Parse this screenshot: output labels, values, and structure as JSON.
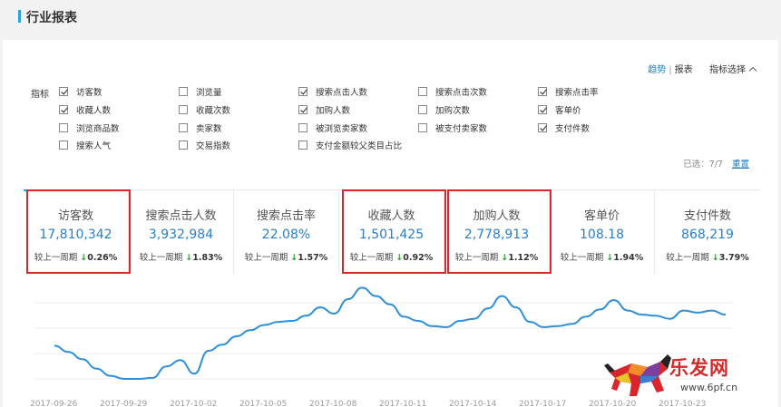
{
  "page": {
    "title": "行业报表"
  },
  "header_links": {
    "trend": "趋势",
    "separator": "|",
    "report": "报表",
    "indicator_select": "指标选择"
  },
  "indicators": {
    "label": "指标",
    "options": [
      {
        "label": "访客数",
        "checked": true
      },
      {
        "label": "浏览量",
        "checked": false
      },
      {
        "label": "搜索点击人数",
        "checked": true
      },
      {
        "label": "搜索点击次数",
        "checked": false
      },
      {
        "label": "搜索点击率",
        "checked": true
      },
      {
        "label": "收藏人数",
        "checked": true
      },
      {
        "label": "收藏次数",
        "checked": false
      },
      {
        "label": "加购人数",
        "checked": true
      },
      {
        "label": "加购次数",
        "checked": false
      },
      {
        "label": "客单价",
        "checked": true
      },
      {
        "label": "浏览商品数",
        "checked": false
      },
      {
        "label": "卖家数",
        "checked": false
      },
      {
        "label": "被浏览卖家数",
        "checked": false
      },
      {
        "label": "被支付卖家数",
        "checked": false
      },
      {
        "label": "支付件数",
        "checked": true
      },
      {
        "label": "搜索人气",
        "checked": false
      },
      {
        "label": "交易指数",
        "checked": false
      },
      {
        "label": "支付金额较父类目占比",
        "checked": false
      }
    ],
    "selected_text": "已选：7/7",
    "reset_label": "重置"
  },
  "metrics": [
    {
      "name": "访客数",
      "value": "17,810,342",
      "compare_label": "较上一周期",
      "direction": "down",
      "arrow": "↓",
      "change": "0.26%",
      "highlighted": true,
      "active": true
    },
    {
      "name": "搜索点击人数",
      "value": "3,932,984",
      "compare_label": "较上一周期",
      "direction": "down",
      "arrow": "↓",
      "change": "1.83%",
      "highlighted": false,
      "active": false
    },
    {
      "name": "搜索点击率",
      "value": "22.08%",
      "compare_label": "较上一周期",
      "direction": "down",
      "arrow": "↓",
      "change": "1.57%",
      "highlighted": false,
      "active": false
    },
    {
      "name": "收藏人数",
      "value": "1,501,425",
      "compare_label": "较上一周期",
      "direction": "down",
      "arrow": "↓",
      "change": "0.92%",
      "highlighted": true,
      "active": false
    },
    {
      "name": "加购人数",
      "value": "2,778,913",
      "compare_label": "较上一周期",
      "direction": "down",
      "arrow": "↓",
      "change": "1.12%",
      "highlighted": true,
      "active": false
    },
    {
      "name": "客单价",
      "value": "108.18",
      "compare_label": "较上一周期",
      "direction": "down",
      "arrow": "↓",
      "change": "1.94%",
      "highlighted": false,
      "active": false
    },
    {
      "name": "支付件数",
      "value": "868,219",
      "compare_label": "较上一周期",
      "direction": "down",
      "arrow": "↓",
      "change": "3.79%",
      "highlighted": false,
      "active": false
    }
  ],
  "colors": {
    "accent": "#2a9fe6",
    "value_blue": "#2a7fc8",
    "down_green": "#2e9a2e",
    "highlight_red": "#d9262c",
    "line": "#2e8fd6"
  },
  "chart_data": {
    "type": "line",
    "series": [
      {
        "values": [
          0.46,
          0.4,
          0.33,
          0.24,
          0.17,
          0.14,
          0.14,
          0.15,
          0.26,
          0.32,
          0.19,
          0.41,
          0.47,
          0.55,
          0.61,
          0.66,
          0.69,
          0.7,
          0.75,
          0.83,
          0.77,
          0.91,
          1.02,
          0.94,
          0.86,
          0.74,
          0.7,
          0.65,
          0.64,
          0.7,
          0.72,
          0.82,
          0.94,
          0.83,
          0.69,
          0.64,
          0.65,
          0.67,
          0.74,
          0.81,
          0.9,
          0.8,
          0.76,
          0.75,
          0.72,
          0.8,
          0.78,
          0.8,
          0.76
        ]
      }
    ],
    "x_ticks": [
      "2017-09-26",
      "2017-09-29",
      "2017-10-02",
      "2017-10-05",
      "2017-10-08",
      "2017-10-11",
      "2017-10-14",
      "2017-10-17",
      "2017-10-20",
      "2017-10-23"
    ],
    "grid": true
  },
  "watermark": {
    "brand": "乐发网",
    "url": "www.6pf.cn"
  }
}
